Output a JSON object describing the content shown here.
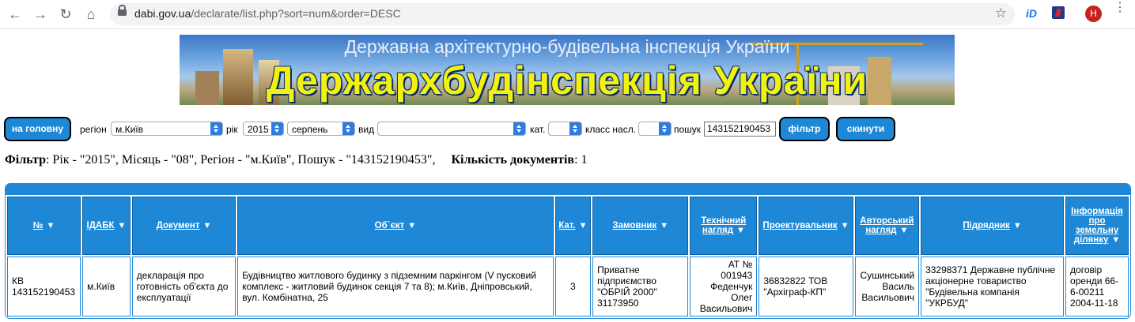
{
  "browser": {
    "url_host": "dabi.gov.ua",
    "url_path": "/declarate/list.php?sort=num&order=DESC",
    "ext1_label": "iD",
    "avatar_letter": "Н"
  },
  "banner": {
    "subtitle": "Державна архітектурно-будівельна інспекція України",
    "title": "Держархбудінспекція України"
  },
  "filters": {
    "home_button": "на головну",
    "region_label": "регіон",
    "region_value": "м.Київ",
    "year_label": "рік",
    "year_value": "2015",
    "month_value": "серпень",
    "type_label": "вид",
    "type_value": "",
    "cat_label": "кат.",
    "cat_value": "",
    "class_label": "класс насл.",
    "class_value": "",
    "search_label": "пошук",
    "search_value": "143152190453",
    "filter_button": "фільтр",
    "reset_button": "скинути"
  },
  "summary": {
    "filter_label": "Фільтр",
    "filter_text": ": Рік - \"2015\", Місяць - \"08\", Регіон - \"м.Київ\", Пошук - \"143152190453\",",
    "count_label": "Кількість документів",
    "count_value": ": 1"
  },
  "table": {
    "columns": [
      {
        "l1": "№",
        "l2": ""
      },
      {
        "l1": "ІДАБК",
        "l2": ""
      },
      {
        "l1": "Документ",
        "l2": ""
      },
      {
        "l1": "Об`єкт",
        "l2": ""
      },
      {
        "l1": "Кат.",
        "l2": ""
      },
      {
        "l1": "Замовник",
        "l2": ""
      },
      {
        "l1": "Технічний",
        "l2": "нагляд"
      },
      {
        "l1": "Проектувальник",
        "l2": ""
      },
      {
        "l1": "Авторський",
        "l2": "нагляд"
      },
      {
        "l1": "Підрядник",
        "l2": ""
      },
      {
        "l1": "Інформація про земельну",
        "l2": "ділянку"
      }
    ],
    "rows": [
      [
        "КВ 143152190453",
        "м.Київ",
        "декларація про готовність об'єкта до експлуатації",
        "Будівництво житлового будинку з підземним паркінгом (V пусковий комплекс - житловий будинок секція 7 та 8); м.Київ, Дніпровський, вул. Комбінатна, 25",
        "3",
        "Приватне підприємство \"ОБРІЙ 2000\" 31173950",
        "АТ № 001943 Феденчук Олег Васильович",
        "36832822 ТОВ \"Архіграф-КП\"",
        "Сушинський Василь Васильович",
        "33298371 Державне публічне акціонерне товариство \"Будівельна компанія \"УКРБУД\"",
        "договір оренди 66-6-00211 2004-11-18"
      ]
    ]
  }
}
